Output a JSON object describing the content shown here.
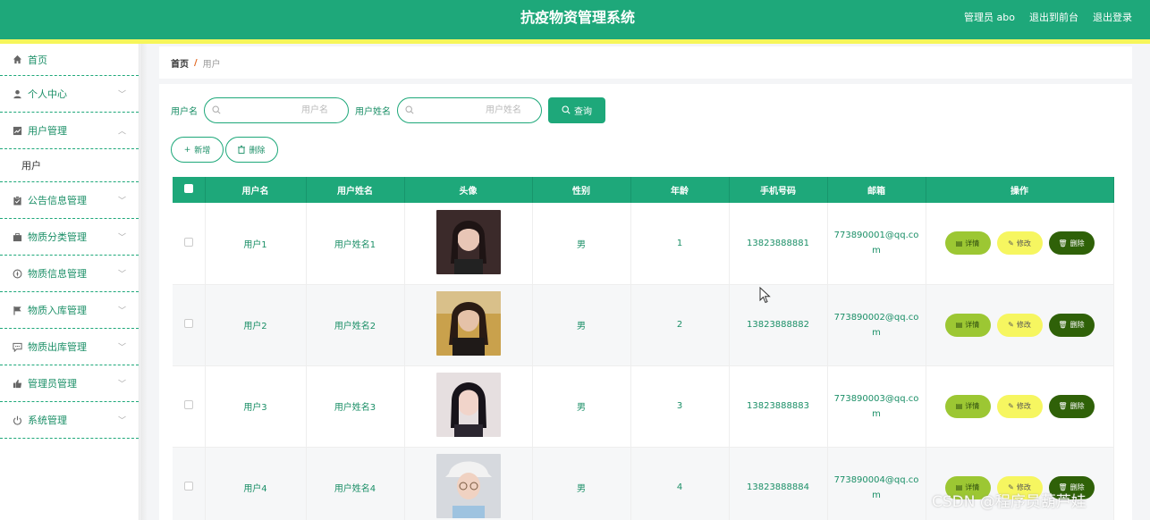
{
  "header": {
    "title": "抗疫物资管理系统",
    "admin_label": "管理员 abo",
    "back_front": "退出到前台",
    "logout": "退出登录"
  },
  "sidebar": {
    "items": [
      {
        "label": "首页",
        "icon": "home-icon"
      },
      {
        "label": "个人中心",
        "icon": "person-icon"
      },
      {
        "label": "用户管理",
        "icon": "chart-icon"
      },
      {
        "label": "用户",
        "sub": true
      },
      {
        "label": "公告信息管理",
        "icon": "clipboard-icon"
      },
      {
        "label": "物质分类管理",
        "icon": "briefcase-icon"
      },
      {
        "label": "物质信息管理",
        "icon": "compass-icon"
      },
      {
        "label": "物质入库管理",
        "icon": "flag-icon"
      },
      {
        "label": "物质出库管理",
        "icon": "message-icon"
      },
      {
        "label": "管理员管理",
        "icon": "thumbs-icon"
      },
      {
        "label": "系统管理",
        "icon": "power-icon"
      }
    ]
  },
  "breadcrumb": {
    "home": "首页",
    "sep": "/",
    "current": "用户"
  },
  "search": {
    "label1": "用户名",
    "placeholder1": "用户名",
    "label2": "用户姓名",
    "placeholder2": "用户姓名",
    "query": "查询"
  },
  "actions": {
    "add": "新增",
    "delete": "删除"
  },
  "table": {
    "headers": [
      "用户名",
      "用户姓名",
      "头像",
      "性别",
      "年龄",
      "手机号码",
      "邮箱",
      "操作"
    ],
    "rows": [
      {
        "username": "用户1",
        "name": "用户姓名1",
        "gender": "男",
        "age": "1",
        "phone": "13823888881",
        "email1": "773890001@qq.co",
        "email2": "m"
      },
      {
        "username": "用户2",
        "name": "用户姓名2",
        "gender": "男",
        "age": "2",
        "phone": "13823888882",
        "email1": "773890002@qq.co",
        "email2": "m"
      },
      {
        "username": "用户3",
        "name": "用户姓名3",
        "gender": "男",
        "age": "3",
        "phone": "13823888883",
        "email1": "773890003@qq.co",
        "email2": "m"
      },
      {
        "username": "用户4",
        "name": "用户姓名4",
        "gender": "男",
        "age": "4",
        "phone": "13823888884",
        "email1": "773890004@qq.co",
        "email2": "m"
      }
    ],
    "op_detail": "详情",
    "op_edit": "修改",
    "op_delete": "删除"
  },
  "watermark": "CSDN @程序员葫芦娃",
  "colors": {
    "primary": "#1ea87a",
    "accent_stripe": "#f6f65a",
    "detail": "#9cc733",
    "edit": "#f6f660",
    "delete": "#2f6108"
  }
}
